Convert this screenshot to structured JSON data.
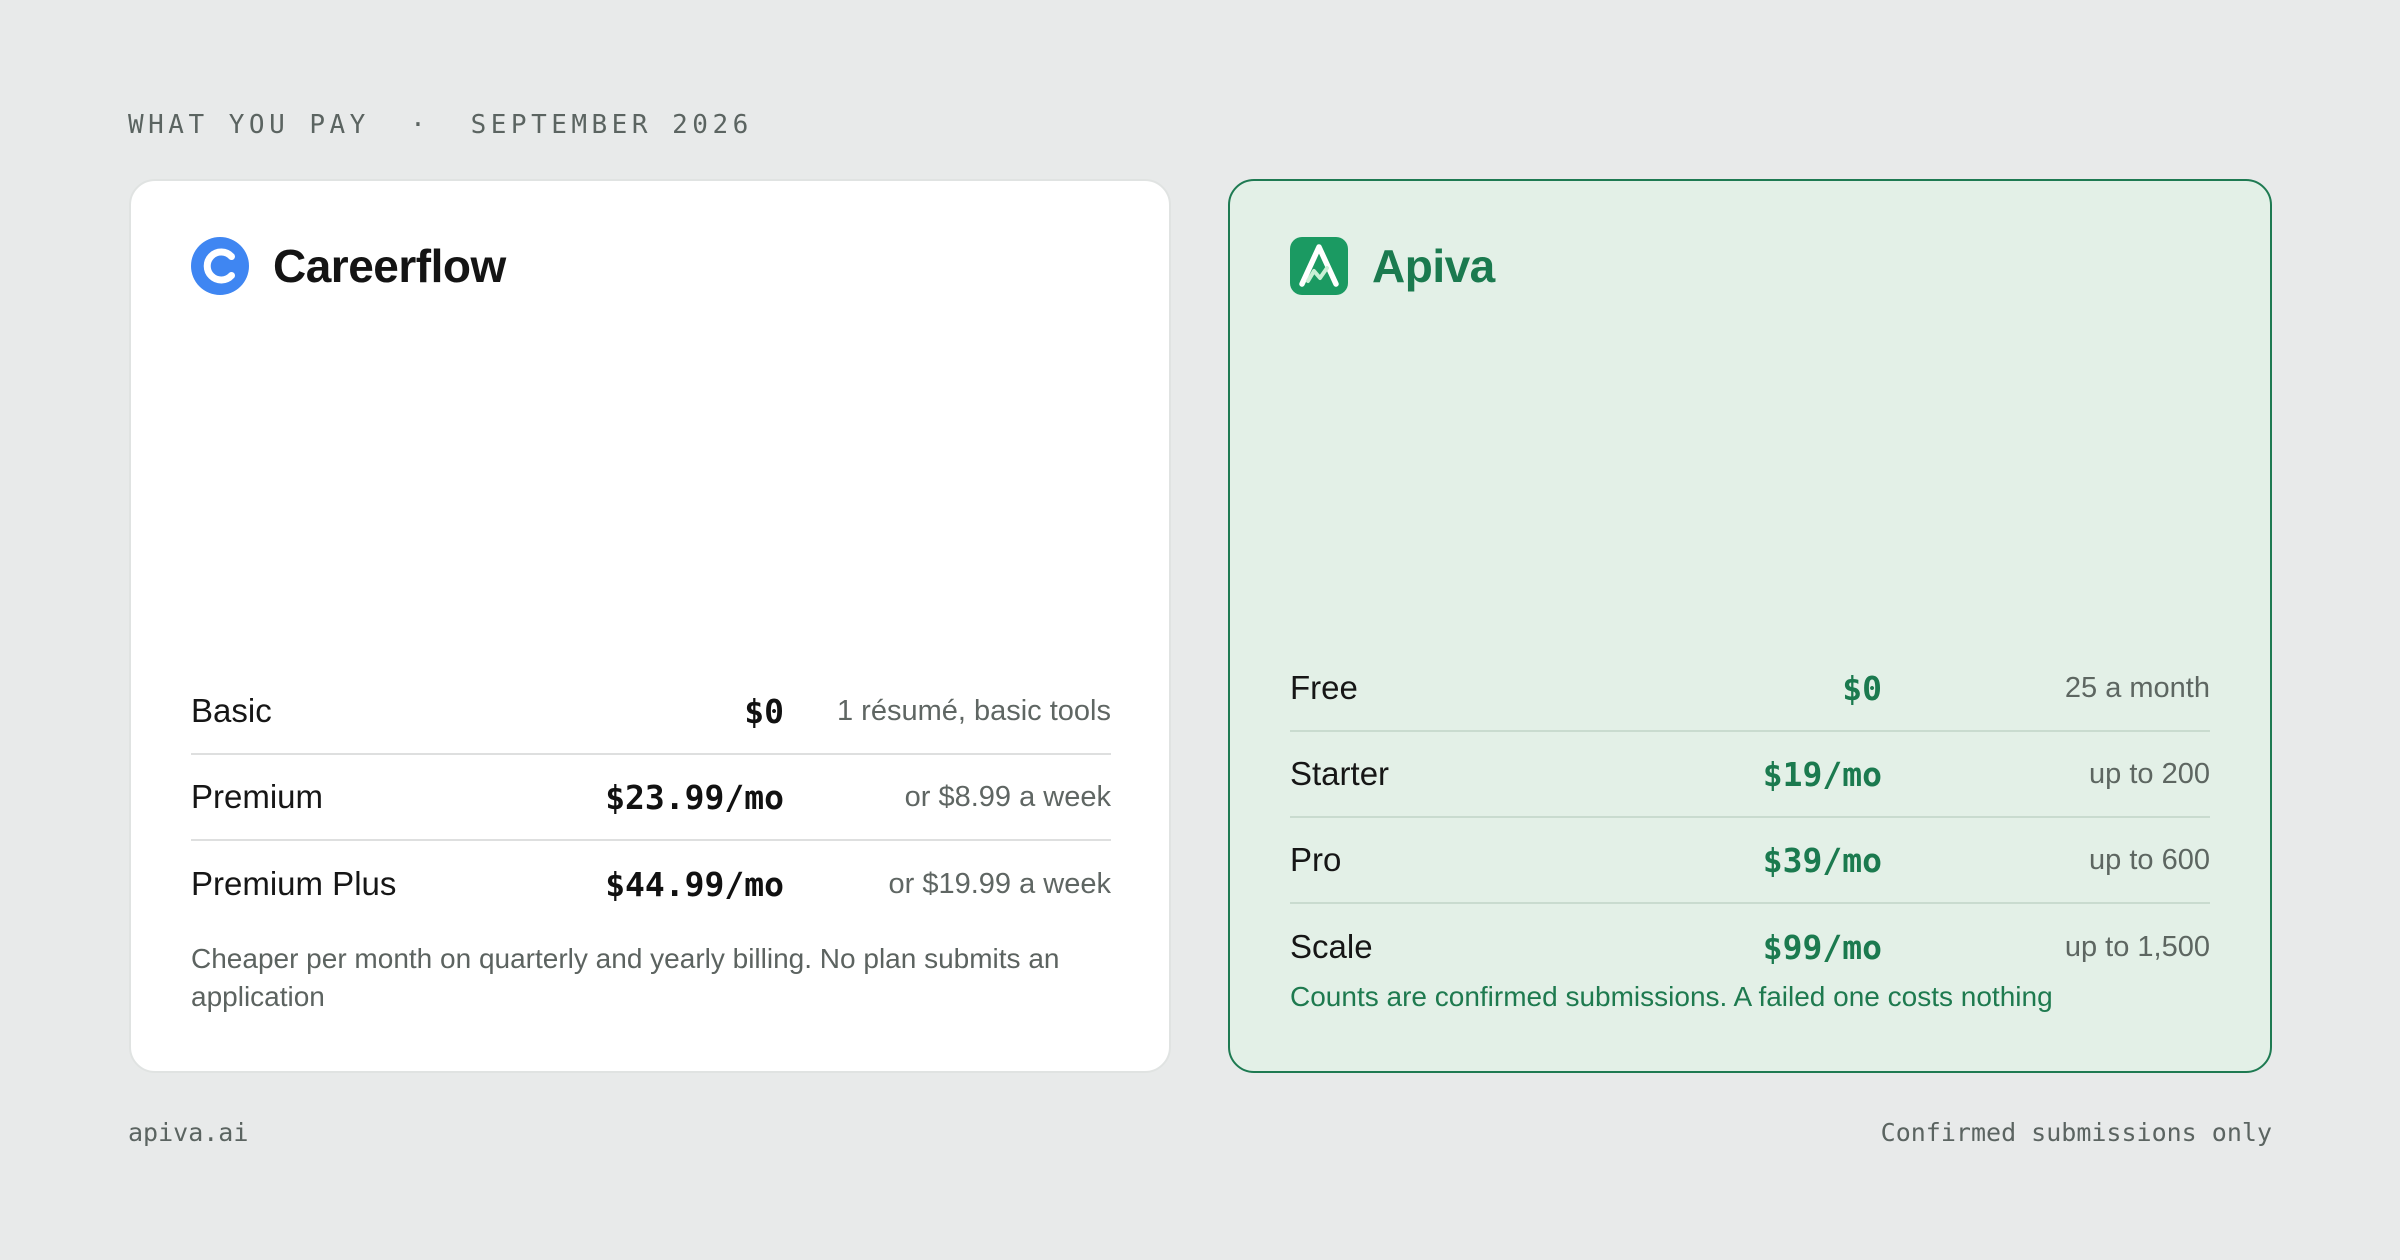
{
  "header": {
    "eyebrow": "WHAT YOU PAY  ·  SEPTEMBER 2026"
  },
  "cards": {
    "careerflow": {
      "brand": "Careerflow",
      "logo_icon": "careerflow-c-logo",
      "accent": "#3f86f2",
      "rows": [
        {
          "plan": "Basic",
          "price": "$0",
          "note": "1 résumé, basic tools"
        },
        {
          "plan": "Premium",
          "price": "$23.99/mo",
          "note": "or $8.99 a week"
        },
        {
          "plan": "Premium Plus",
          "price": "$44.99/mo",
          "note": "or $19.99 a week"
        }
      ],
      "footnote": "Cheaper per month on quarterly and yearly billing. No plan submits an application"
    },
    "apiva": {
      "brand": "Apiva",
      "logo_icon": "apiva-a-logo",
      "accent": "#1b7a4f",
      "rows": [
        {
          "plan": "Free",
          "price": "$0",
          "note": "25 a month"
        },
        {
          "plan": "Starter",
          "price": "$19/mo",
          "note": "up to 200"
        },
        {
          "plan": "Pro",
          "price": "$39/mo",
          "note": "up to 600"
        },
        {
          "plan": "Scale",
          "price": "$99/mo",
          "note": "up to 1,500"
        }
      ],
      "footnote": "Counts are confirmed submissions. A failed one costs nothing"
    }
  },
  "footer": {
    "left": "apiva.ai",
    "right": "Confirmed submissions only"
  }
}
